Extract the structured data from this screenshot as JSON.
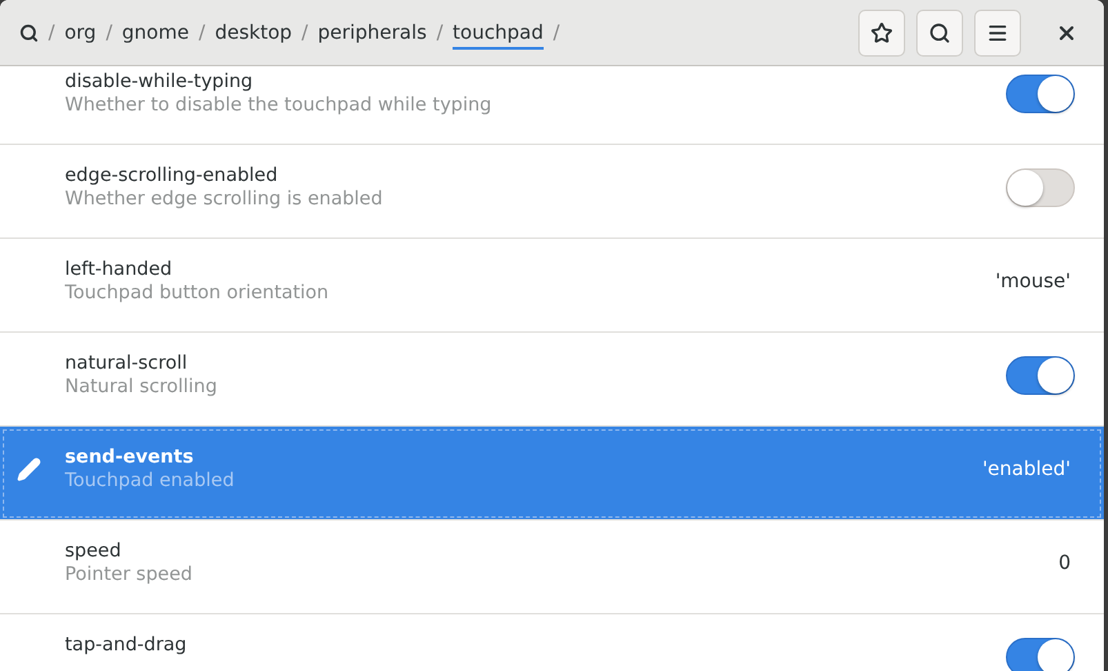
{
  "path": {
    "segments": [
      {
        "label": "org",
        "selected": false
      },
      {
        "label": "gnome",
        "selected": false
      },
      {
        "label": "desktop",
        "selected": false
      },
      {
        "label": "peripherals",
        "selected": false
      },
      {
        "label": "touchpad",
        "selected": true
      }
    ],
    "separator": "/"
  },
  "keys": [
    {
      "name": "disable-while-typing",
      "summary": "Whether to disable the touchpad while typing",
      "kind": "toggle",
      "on": true,
      "selected": false
    },
    {
      "name": "edge-scrolling-enabled",
      "summary": "Whether edge scrolling is enabled",
      "kind": "toggle",
      "on": false,
      "selected": false
    },
    {
      "name": "left-handed",
      "summary": "Touchpad button orientation",
      "kind": "value",
      "value": "'mouse'",
      "selected": false
    },
    {
      "name": "natural-scroll",
      "summary": "Natural scrolling",
      "kind": "toggle",
      "on": true,
      "selected": false
    },
    {
      "name": "send-events",
      "summary": "Touchpad enabled",
      "kind": "value",
      "value": "'enabled'",
      "selected": true
    },
    {
      "name": "speed",
      "summary": "Pointer speed",
      "kind": "value",
      "value": "0",
      "selected": false
    },
    {
      "name": "tap-and-drag",
      "kind": "toggle",
      "on": true,
      "selected": false
    }
  ]
}
